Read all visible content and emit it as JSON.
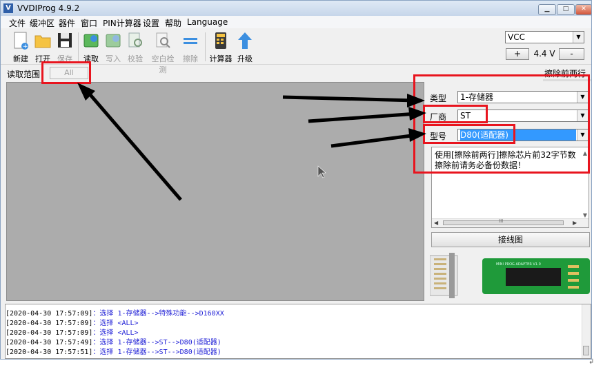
{
  "window": {
    "title": "VVDIProg 4.9.2"
  },
  "menu": [
    "文件",
    "缓冲区",
    "器件",
    "窗口",
    "PIN计算器",
    "设置",
    "帮助",
    "Language"
  ],
  "toolbar": {
    "new": "新建",
    "open": "打开",
    "save": "保存",
    "read": "读取",
    "write": "写入",
    "verify": "校验",
    "blank_check": "空白检测",
    "erase": "擦除",
    "calculator": "计算器",
    "upgrade": "升级"
  },
  "power": {
    "selected": "VCC",
    "plus": "+",
    "voltage": "4.4 V",
    "minus": "-"
  },
  "range": {
    "label": "读取范围",
    "value": "All"
  },
  "erase_title": "擦除前两行",
  "chip": {
    "type_label": "类型",
    "type_value": "1-存储器",
    "vendor_label": "厂商",
    "vendor_value": "ST",
    "model_label": "型号",
    "model_value": "D80(适配器)"
  },
  "notes": {
    "line1": "使用[擦除前两行]擦除芯片前32字节数",
    "line2": "擦除前请务必备份数据！",
    "scroll_thumb": "III"
  },
  "wiring_button": "接线图",
  "adapter_text": "MINI PROG ADAPTER V1.0",
  "log": [
    {
      "time": "[2020-04-30 17:57:09]",
      "msg": "：选择 1-存储器-->特殊功能-->D160XX"
    },
    {
      "time": "[2020-04-30 17:57:09]",
      "msg": "：选择 <ALL>"
    },
    {
      "time": "[2020-04-30 17:57:09]",
      "msg": "：选择 <ALL>"
    },
    {
      "time": "[2020-04-30 17:57:49]",
      "msg": "：选择 1-存储器-->ST-->D80(适配器)"
    },
    {
      "time": "[2020-04-30 17:57:51]",
      "msg": "：选择 1-存储器-->ST-->D80(适配器)"
    }
  ],
  "annotations": {
    "highlight_color": "#e8141e",
    "arrow_color": "#000000"
  }
}
